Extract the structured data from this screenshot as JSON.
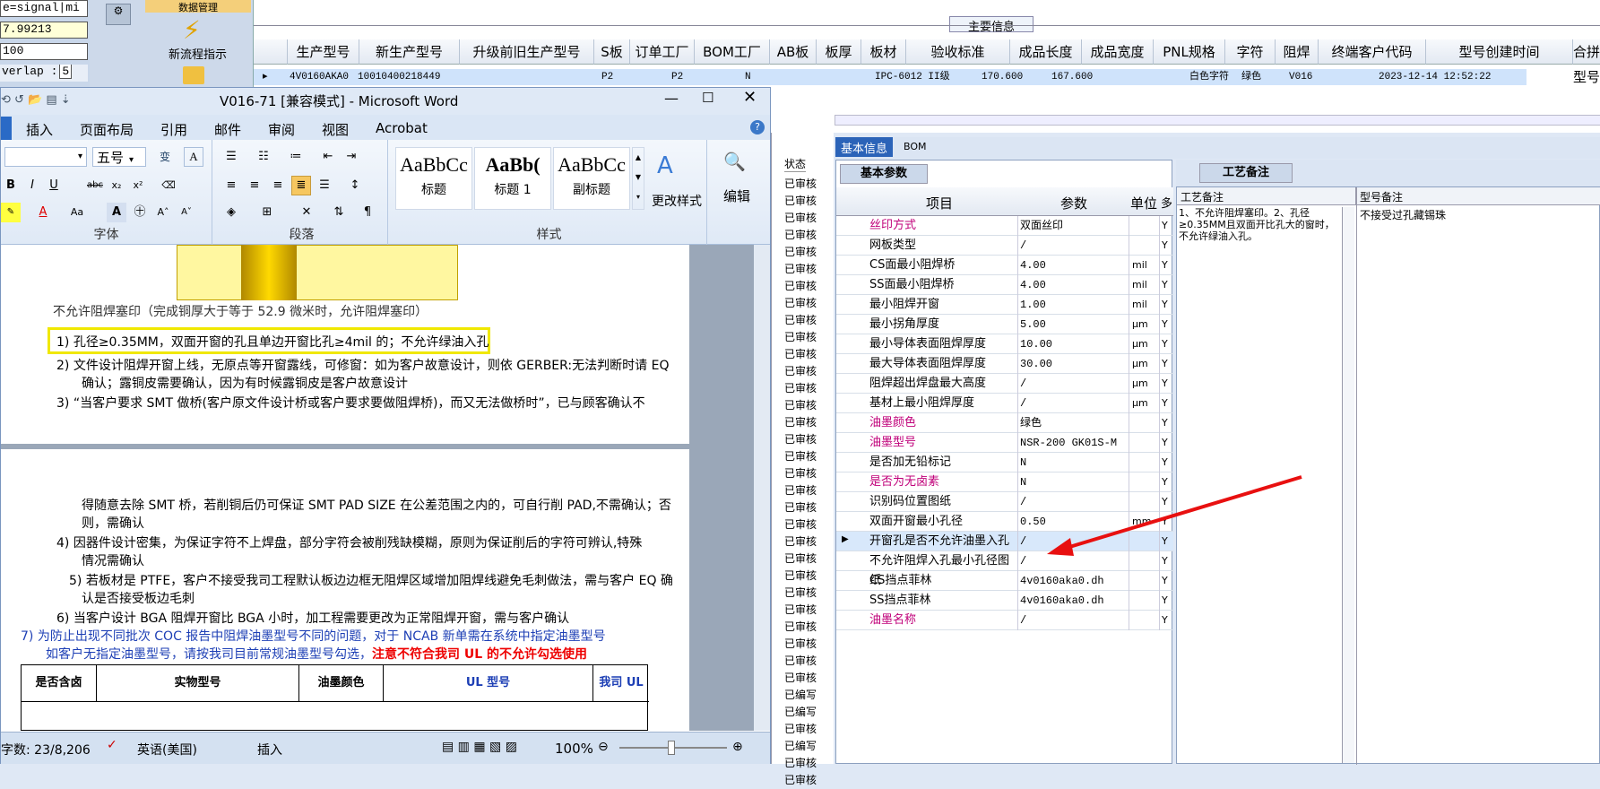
{
  "left_strip": {
    "r1": "e=signal|mi",
    "r2": "7.99213",
    "r3": "100",
    "r4": "verlap :",
    "r4b": "5"
  },
  "toolbar": {
    "item1": "数据管理",
    "item2": "新流程指示"
  },
  "main_info": {
    "title": "主要信息",
    "headers": [
      "生产型号",
      "新生产型号",
      "升级前旧生产型号",
      "S板",
      "订单工厂",
      "BOM工厂",
      "AB板",
      "板厚",
      "板材",
      "验收标准",
      "成品长度",
      "成品宽度",
      "PNL规格",
      "字符",
      "阻焊",
      "终端客户代码",
      "型号创建时间",
      "合拼型号"
    ],
    "row": [
      "4V0160AKA0",
      "10010400218449",
      "",
      "",
      "P2",
      "P2",
      "N",
      "",
      "",
      "IPC-6012 II级",
      "170.600",
      "167.600",
      "",
      "白色字符",
      "绿色",
      "V016",
      "2023-12-14 12:52:22",
      ""
    ]
  },
  "word": {
    "title": "V016-71 [兼容模式] - Microsoft Word",
    "tabs": [
      "插入",
      "页面布局",
      "引用",
      "邮件",
      "审阅",
      "视图",
      "Acrobat"
    ],
    "font_size": "五号",
    "groups": {
      "font": "字体",
      "para": "段落",
      "styles": "样式"
    },
    "styles": [
      {
        "sample": "AaBbCc",
        "name": "标题"
      },
      {
        "sample": "AaBb(",
        "name": "标题 1"
      },
      {
        "sample": "AaBbCc",
        "name": "副标题"
      }
    ],
    "change_styles": "更改样式",
    "edit": "编辑",
    "doc": {
      "l0": "不允许阻焊塞印（完成铜厚大于等于 52.9 微米时，允许阻焊塞印）",
      "l1": "1) 孔径≥0.35MM，双面开窗的孔且单边开窗比孔≥4mil 的；不允许绿油入孔",
      "l2": "2) 文件设计阻焊开窗上线，无原点等开窗露线，可修窗：如为客户故意设计，则依 GERBER:无法判断时请 EQ",
      "l2b": "确认；露铜皮需要确认，因为有时候露铜皮是客户故意设计",
      "l3": "3) “当客户要求 SMT 做桥(客户原文件设计桥或客户要求要做阻焊桥)，而又无法做桥时”，已与顾客确认不",
      "p2l1": "得随意去除 SMT 桥，若削铜后仍可保证 SMT PAD SIZE 在公差范围之内的，可自行削 PAD,不需确认；否",
      "p2l1b": "则，需确认",
      "p2l2": "4) 因器件设计密集，为保证字符不上焊盘，部分字符会被削残缺模糊，原则为保证削后的字符可辨认,特殊",
      "p2l2b": "情况需确认",
      "p2l3": "5) 若板材是 PTFE，客户不接受我司工程默认板边边框无阻焊区域增加阻焊线避免毛刺做法，需与客户 EQ 确",
      "p2l3b": "认是否接受板边毛刺",
      "p2l4": "6) 当客户设计 BGA 阻焊开窗比 BGA 小时，加工程需要更改为正常阻焊开窗，需与客户确认",
      "p2l5": "7)   为防止出现不同批次 COC 报告中阻焊油墨型号不同的问题，对于 NCAB 新单需在系统中指定油墨型号",
      "p2l6a": "如客户无指定油墨型号，请按我司目前常规油墨型号勾选，",
      "p2l6b": "注意不符合我司 UL 的不允许勾选使用",
      "table_headers": [
        "是否含卤",
        "实物型号",
        "油墨颜色",
        "UL 型号",
        "我司 UL"
      ]
    },
    "status": {
      "words": "字数: 23/8,206",
      "lang": "英语(美国)",
      "mode": "插入",
      "zoom": "100%"
    }
  },
  "middle": {
    "header": "状态",
    "rows": [
      "已审核",
      "已审核",
      "已审核",
      "已审核",
      "已审核",
      "已审核",
      "已审核",
      "已审核",
      "已审核",
      "已审核",
      "已审核",
      "已审核",
      "已审核",
      "已审核",
      "已审核",
      "已审核",
      "已审核",
      "已审核",
      "已审核",
      "已审核",
      "已审核",
      "已审核",
      "已审核",
      "已审核",
      "已审核",
      "已审核",
      "已审核",
      "已审核",
      "已审核",
      "已审核",
      "已编写",
      "已编写",
      "已审核",
      "已编写",
      "已审核",
      "已审核"
    ]
  },
  "param": {
    "tabs": [
      "基本信息",
      "BOM"
    ],
    "subtab": "基本参数",
    "headers": [
      "项目",
      "参数",
      "单位",
      "多"
    ],
    "rows": [
      {
        "name": "丝印方式",
        "value": "双面丝印",
        "unit": "",
        "flag": "Y",
        "red": true
      },
      {
        "name": "网板类型",
        "value": "/",
        "unit": "",
        "flag": "Y",
        "red": false
      },
      {
        "name": "CS面最小阻焊桥",
        "value": "4.00",
        "unit": "mil",
        "flag": "Y",
        "red": false
      },
      {
        "name": "SS面最小阻焊桥",
        "value": "4.00",
        "unit": "mil",
        "flag": "Y",
        "red": false
      },
      {
        "name": "最小阻焊开窗",
        "value": "1.00",
        "unit": "mil",
        "flag": "Y",
        "red": false
      },
      {
        "name": "最小拐角厚度",
        "value": "5.00",
        "unit": "μm",
        "flag": "Y",
        "red": false
      },
      {
        "name": "最小导体表面阻焊厚度",
        "value": "10.00",
        "unit": "μm",
        "flag": "Y",
        "red": false
      },
      {
        "name": "最大导体表面阻焊厚度",
        "value": "30.00",
        "unit": "μm",
        "flag": "Y",
        "red": false
      },
      {
        "name": "阻焊超出焊盘最大高度",
        "value": "/",
        "unit": "μm",
        "flag": "Y",
        "red": false
      },
      {
        "name": "基材上最小阻焊厚度",
        "value": "/",
        "unit": "μm",
        "flag": "Y",
        "red": false
      },
      {
        "name": "油墨颜色",
        "value": "绿色",
        "unit": "",
        "flag": "Y",
        "red": true
      },
      {
        "name": "油墨型号",
        "value": "NSR-200 GK01S-M",
        "unit": "",
        "flag": "Y",
        "red": true
      },
      {
        "name": "是否加无铅标记",
        "value": "N",
        "unit": "",
        "flag": "Y",
        "red": false
      },
      {
        "name": "是否为无卤素",
        "value": "N",
        "unit": "",
        "flag": "Y",
        "red": true
      },
      {
        "name": "识别码位置图纸",
        "value": "/",
        "unit": "",
        "flag": "Y",
        "red": false
      },
      {
        "name": "双面开窗最小孔径",
        "value": "0.50",
        "unit": "mm",
        "flag": "Y",
        "red": false
      },
      {
        "name": "开窗孔是否不允许油墨入孔",
        "value": "/",
        "unit": "",
        "flag": "Y",
        "red": false
      },
      {
        "name": "不允许阻焊入孔最小孔径图纸",
        "value": "/",
        "unit": "",
        "flag": "Y",
        "red": false
      },
      {
        "name": "CS挡点菲林",
        "value": "4v0160aka0.dh",
        "unit": "",
        "flag": "Y",
        "red": false
      },
      {
        "name": "SS挡点菲林",
        "value": "4v0160aka0.dh",
        "unit": "",
        "flag": "Y",
        "red": false
      },
      {
        "name": "油墨名称",
        "value": "/",
        "unit": "",
        "flag": "Y",
        "red": true
      }
    ]
  },
  "craft": {
    "tab": "工艺备注",
    "h1": "工艺备注",
    "h2": "型号备注",
    "note1": "1、不允许阻焊塞印。2、孔径≥0.35MM且双面开比孔大的窗时，不允许绿油入孔。",
    "note2": "不接受过孔藏锡珠"
  }
}
